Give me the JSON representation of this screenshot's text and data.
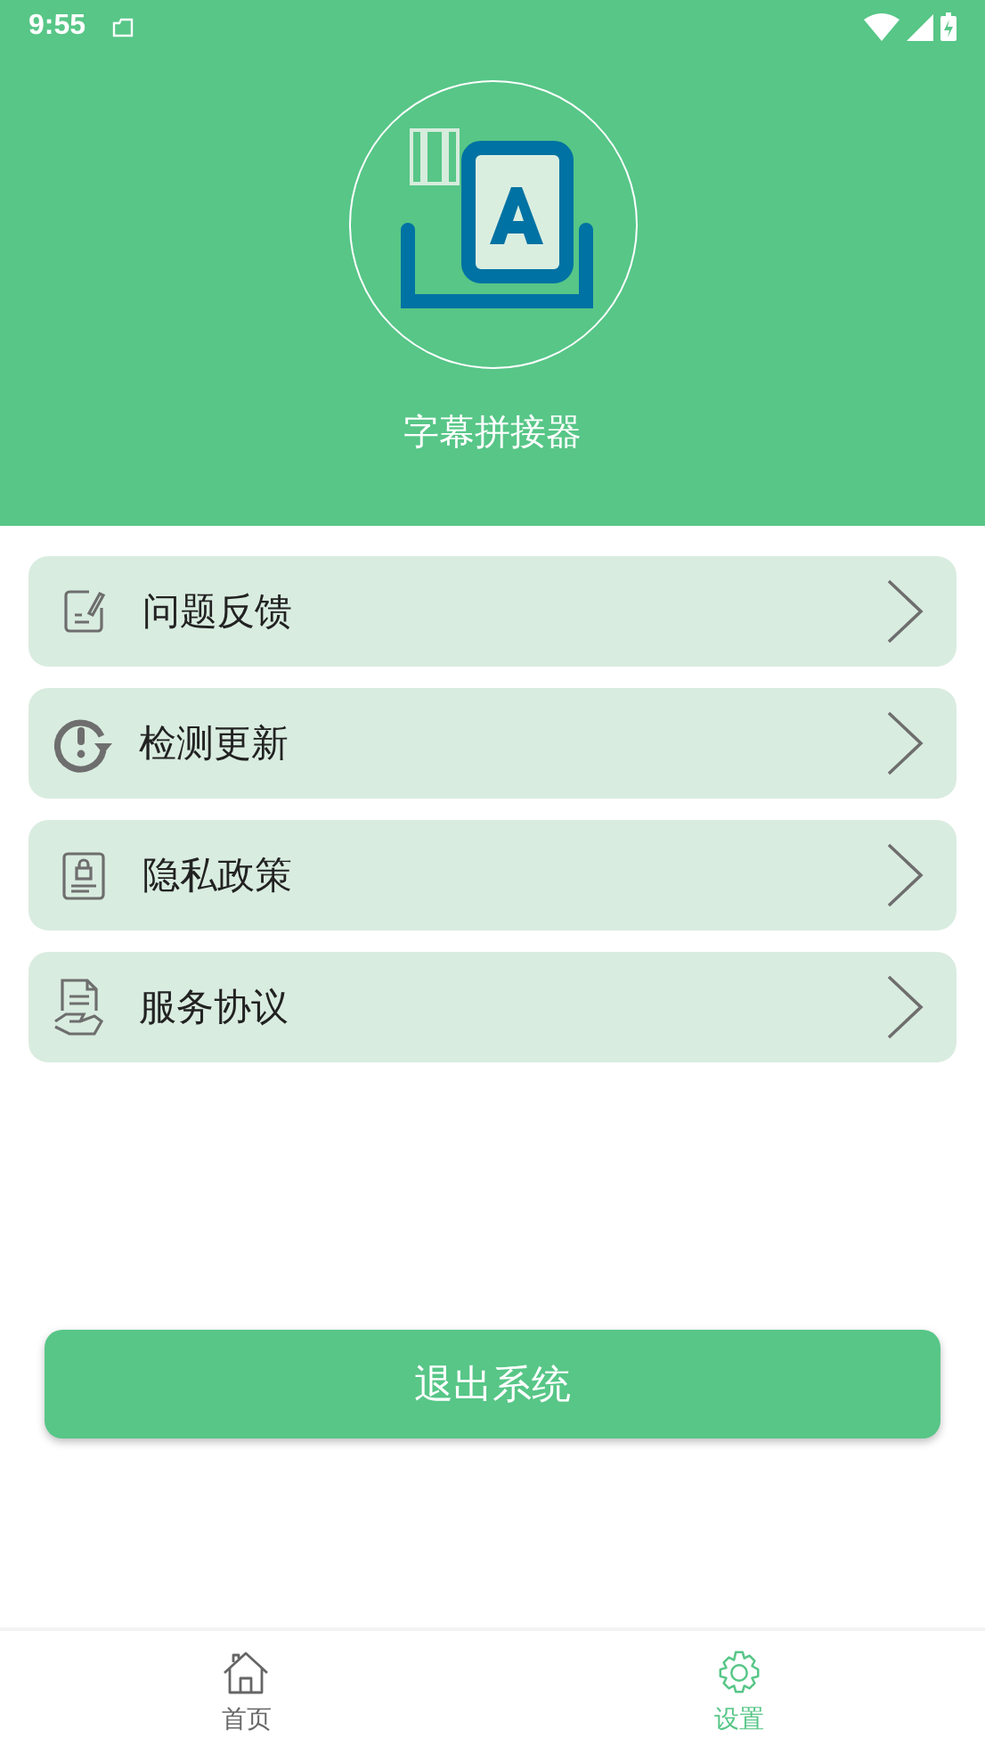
{
  "status_bar": {
    "time": "9:55"
  },
  "header": {
    "app_name": "字幕拼接器"
  },
  "menu": [
    {
      "kind": "feedback",
      "label": "问题反馈"
    },
    {
      "kind": "update",
      "label": "检测更新"
    },
    {
      "kind": "privacy",
      "label": "隐私政策"
    },
    {
      "kind": "agreement",
      "label": "服务协议"
    }
  ],
  "logout_button": "退出系统",
  "tabs": [
    {
      "kind": "home",
      "label": "首页",
      "selected": false
    },
    {
      "kind": "settings",
      "label": "设置",
      "selected": true
    }
  ]
}
